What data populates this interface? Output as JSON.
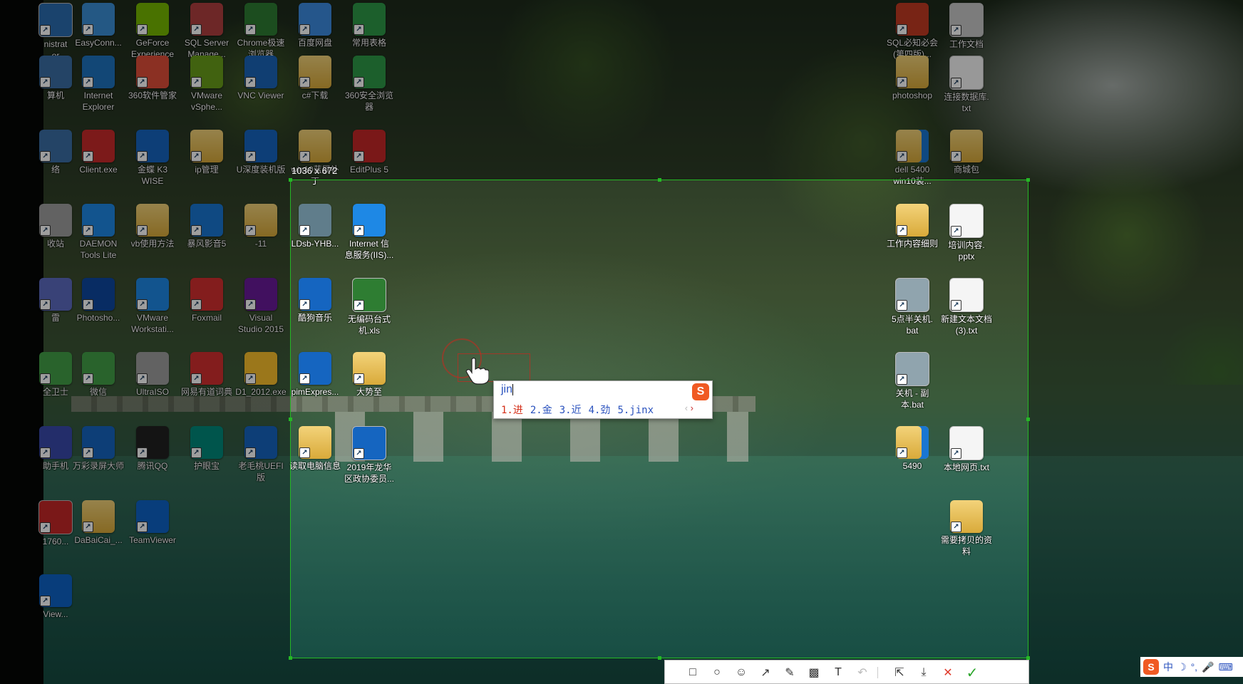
{
  "capture": {
    "size_label": "1036 x 672"
  },
  "ime": {
    "input": "jin",
    "candidates": [
      "1.进",
      "2.金",
      "3.近",
      "4.劲",
      "5.jinx"
    ],
    "prev": "‹",
    "next": "›",
    "logo": "S"
  },
  "tray": {
    "logo": "S",
    "lang": "中",
    "items": [
      "☽",
      "°,",
      "🎤",
      "⌨"
    ]
  },
  "toolbar": {
    "tools": [
      "rectangle-icon",
      "ellipse-icon",
      "mosaic-icon",
      "arrow-icon",
      "pen-icon",
      "highlight-icon",
      "text-icon",
      "undo-icon",
      "share-icon",
      "download-icon",
      "cancel-icon",
      "confirm-icon"
    ],
    "glyphs": [
      "□",
      "○",
      "☺",
      "↗",
      "✎",
      "▩",
      "T",
      "↶",
      "⇱",
      "⤓",
      "✕",
      "✓"
    ],
    "colors": {
      "cancel": "#e03a2b",
      "confirm": "#2aa52a",
      "disabled": "#bbbbbb"
    }
  },
  "desktop_icons": [
    {
      "label": "nistrat\nor"
    },
    {
      "label": "EasyConn..."
    },
    {
      "label": "GeForce\nExperience"
    },
    {
      "label": "SQL Server\nManage..."
    },
    {
      "label": "Chrome极速\n浏览器"
    },
    {
      "label": "百度网盘"
    },
    {
      "label": "常用表格"
    },
    {
      "label": "SQL必知必会\n(第四版)..."
    },
    {
      "label": "工作文档"
    },
    {
      "label": "算机"
    },
    {
      "label": "Internet\nExplorer"
    },
    {
      "label": "360软件管家"
    },
    {
      "label": "VMware\nvSphe..."
    },
    {
      "label": "VNC Viewer"
    },
    {
      "label": "c#下载"
    },
    {
      "label": "360安全浏览\n器"
    },
    {
      "label": "photoshop"
    },
    {
      "label": "连接数据库.\ntxt"
    },
    {
      "label": "络"
    },
    {
      "label": "Client.exe"
    },
    {
      "label": "金蝶 K3\nWISE"
    },
    {
      "label": "ip管理"
    },
    {
      "label": "U深度装机版"
    },
    {
      "label": "win10蓝屏补\n丁"
    },
    {
      "label": "EditPlus 5"
    },
    {
      "label": "dell 5400\nwin10装..."
    },
    {
      "label": "商城包"
    },
    {
      "label": "收站"
    },
    {
      "label": "DAEMON\nTools Lite"
    },
    {
      "label": "vb使用方法"
    },
    {
      "label": "暴风影音5"
    },
    {
      "label": "-11"
    },
    {
      "label": "LDsb-YHB..."
    },
    {
      "label": "Internet 信\n息服务(IIS)..."
    },
    {
      "label": "工作内容细则"
    },
    {
      "label": "培训内容.\npptx"
    },
    {
      "label": "雷"
    },
    {
      "label": "Photosho..."
    },
    {
      "label": "VMware\nWorkstati..."
    },
    {
      "label": "Foxmail"
    },
    {
      "label": "Visual\nStudio 2015"
    },
    {
      "label": "酷狗音乐"
    },
    {
      "label": "无编码台式\n机.xls"
    },
    {
      "label": "5点半关机.\nbat"
    },
    {
      "label": "新建文本文档\n(3).txt"
    },
    {
      "label": "全卫士"
    },
    {
      "label": "微信"
    },
    {
      "label": "UltraISO"
    },
    {
      "label": "网易有道词典"
    },
    {
      "label": "D1_2012.exe"
    },
    {
      "label": "pimExpres..."
    },
    {
      "label": "大势至"
    },
    {
      "label": "关机 - 副\n本.bat"
    },
    {
      "label": "助手机"
    },
    {
      "label": "万彩录屏大师"
    },
    {
      "label": "腾讯QQ"
    },
    {
      "label": "护眼宝"
    },
    {
      "label": "老毛桃UEFI\n版"
    },
    {
      "label": "读取电脑信息"
    },
    {
      "label": "2019年龙华\n区政协委员..."
    },
    {
      "label": "5490"
    },
    {
      "label": "本地网页.txt"
    },
    {
      "label": "1760..."
    },
    {
      "label": "DaBaiCai_..."
    },
    {
      "label": "TeamViewer"
    },
    {
      "label": "需要拷贝的资\n料"
    },
    {
      "label": "View..."
    }
  ]
}
